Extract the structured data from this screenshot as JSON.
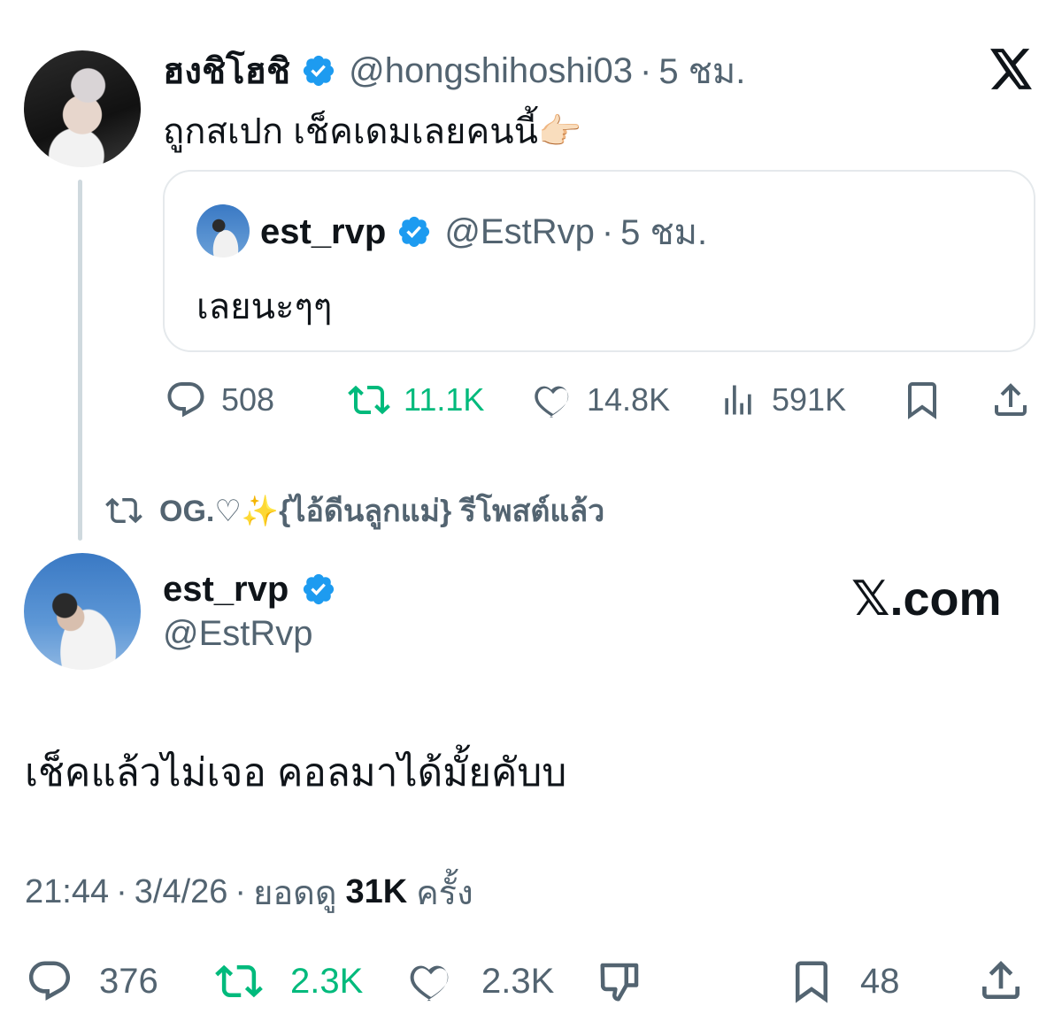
{
  "top_tweet": {
    "display_name": "ฮงชิโฮชิ",
    "handle": "@hongshihoshi03",
    "dot": "·",
    "time": "5 ชม.",
    "text": "ถูกสเปก เช็คเดมเลยคนนี้👉🏻",
    "quote": {
      "display_name": "est_rvp",
      "handle": "@EstRvp",
      "dot": "·",
      "time": "5 ชม.",
      "text": "เลยนะๆๆ"
    },
    "actions": {
      "replies": "508",
      "reposts": "11.1K",
      "likes": "14.8K",
      "views": "591K"
    }
  },
  "repost_banner": {
    "text": "OG.♡✨{ไอ้ดีนลูกแม่} รีโพสต์แล้ว"
  },
  "main_tweet": {
    "display_name": "est_rvp",
    "handle": "@EstRvp",
    "site_label": "𝕏.com",
    "text": "เช็คแล้วไม่เจอ คอลมาได้มั้ยคับบ",
    "meta": {
      "time": "21:44",
      "dot1": "·",
      "date": "3/4/26",
      "dot2": "·",
      "views_prefix": "ยอดดู",
      "views_count": "31K",
      "views_suffix": "ครั้ง"
    },
    "actions": {
      "replies": "376",
      "reposts": "2.3K",
      "likes": "2.3K",
      "bookmarks": "48"
    }
  },
  "colors": {
    "verified": "#1d9bf0",
    "repost_green": "#00ba7c",
    "muted": "#536471"
  },
  "icons": [
    "x-logo-icon",
    "verified-badge-icon",
    "reply-icon",
    "repost-icon",
    "like-icon",
    "views-icon",
    "bookmark-icon",
    "share-icon",
    "dislike-icon"
  ]
}
